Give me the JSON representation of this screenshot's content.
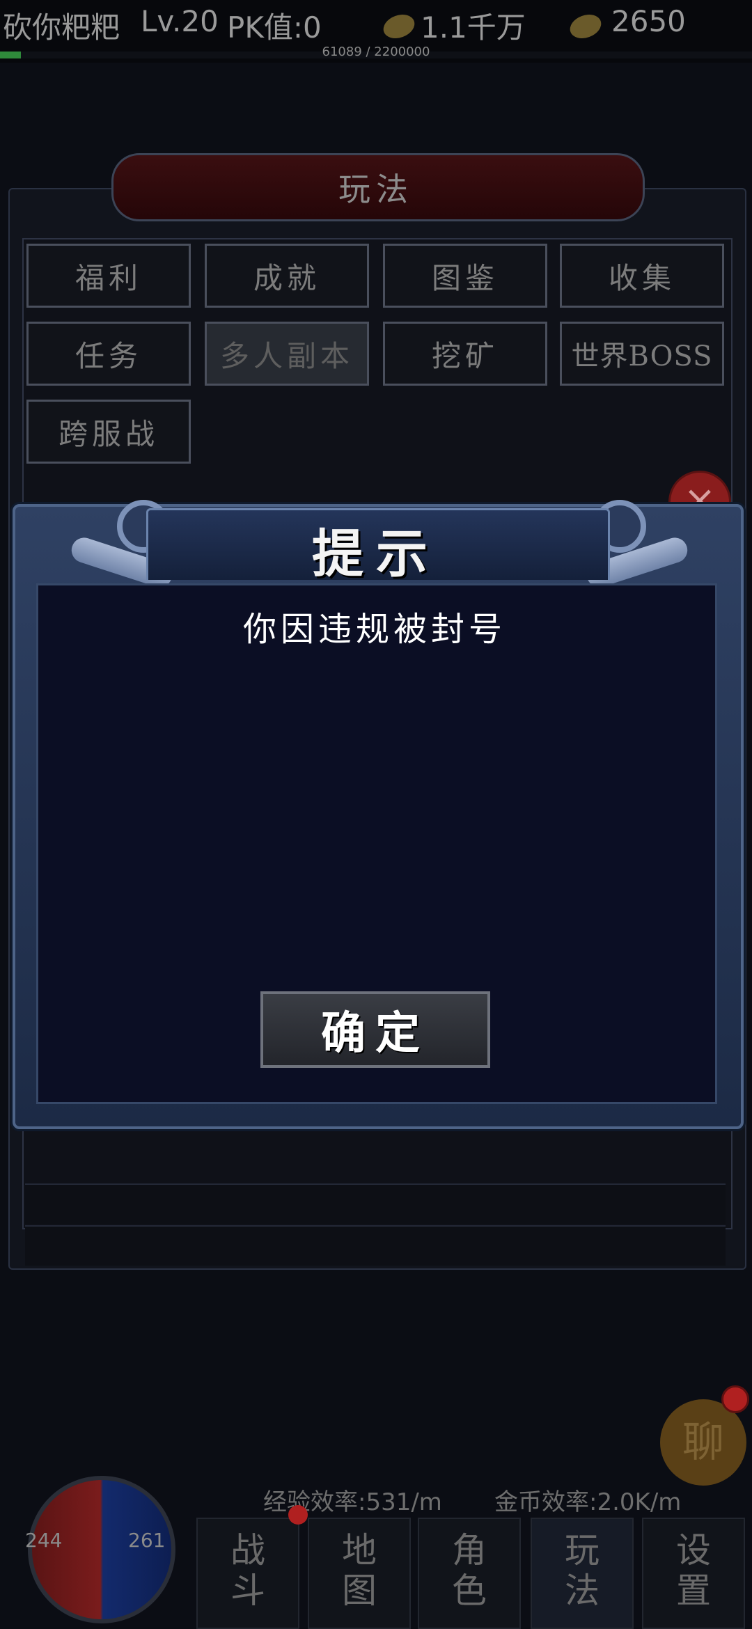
{
  "top_bar": {
    "player_name": "砍你粑粑",
    "level": "Lv.20",
    "pk_value": "PK值:0",
    "copper": "1.1千万",
    "ingot": "2650",
    "exp_text": "61089 / 2200000",
    "exp_progress": 0.028
  },
  "background_panel": {
    "title": "玩法",
    "grid_buttons": [
      "福利",
      "成就",
      "图鉴",
      "收集",
      "任务",
      "多人副本",
      "挖矿",
      "世界BOSS",
      "跨服战"
    ],
    "active_button": "多人副本",
    "close_icon": "close-icon"
  },
  "modal": {
    "title": "提示",
    "message": "你因违规被封号",
    "confirm_label": "确定"
  },
  "hud": {
    "hp": "244",
    "mp": "261",
    "exp_rate": "经验效率:531/m",
    "gold_rate": "金币效率:2.0K/m",
    "chat_label": "聊",
    "nav": [
      {
        "top": "战",
        "bottom": "斗"
      },
      {
        "top": "地",
        "bottom": "图"
      },
      {
        "top": "角",
        "bottom": "色"
      },
      {
        "top": "玩",
        "bottom": "法"
      },
      {
        "top": "设",
        "bottom": "置"
      }
    ]
  },
  "colors": {
    "modal_frame": "#2f4163",
    "modal_body": "#0b0e24",
    "close_red": "#8a1d1d",
    "exp_green": "#2f8a3b"
  }
}
